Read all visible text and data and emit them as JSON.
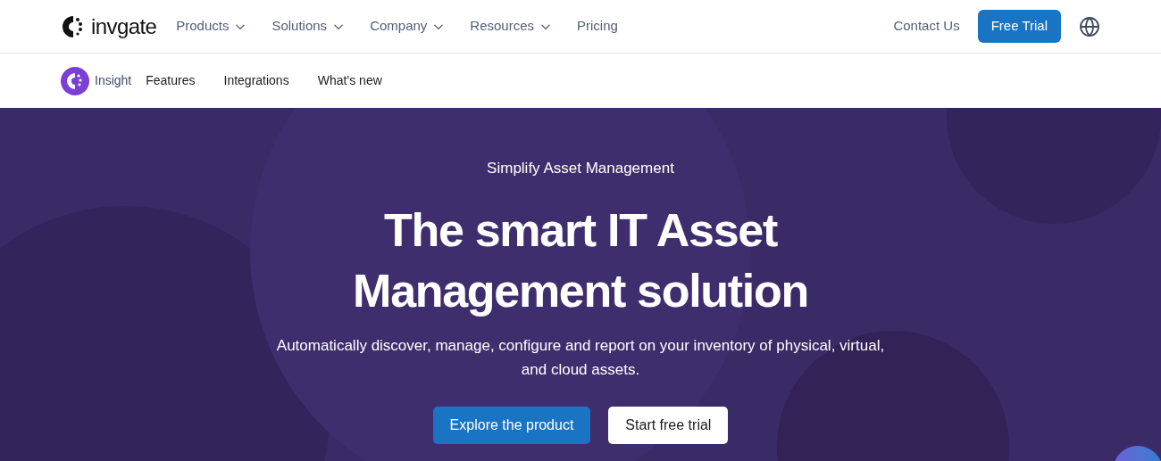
{
  "header": {
    "logo": "invgate",
    "nav": [
      {
        "label": "Products",
        "dropdown": true
      },
      {
        "label": "Solutions",
        "dropdown": true
      },
      {
        "label": "Company",
        "dropdown": true
      },
      {
        "label": "Resources",
        "dropdown": true
      },
      {
        "label": "Pricing",
        "dropdown": false
      }
    ],
    "contact": "Contact Us",
    "cta": "Free Trial"
  },
  "subnav": {
    "product": "Insight",
    "links": [
      "Features",
      "Integrations",
      "What’s new"
    ]
  },
  "hero": {
    "eyebrow": "Simplify Asset Management",
    "title": "The smart IT Asset Management solution",
    "description": "Automatically discover, manage, configure and report on your inventory of physical, virtual, and cloud assets.",
    "primary": "Explore the product",
    "secondary": "Start free trial"
  }
}
